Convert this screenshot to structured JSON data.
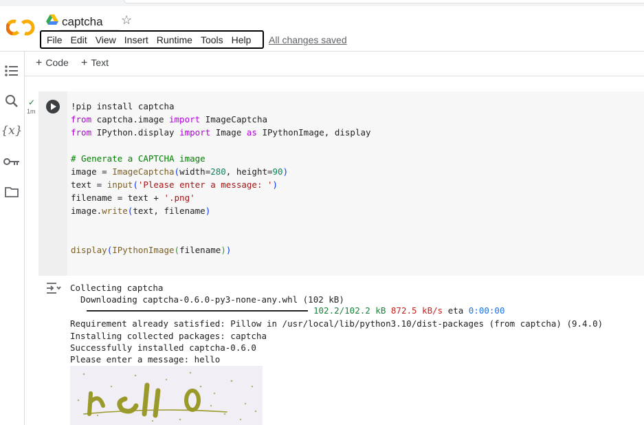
{
  "app": {
    "notebook_title": "captcha",
    "save_status": "All changes saved"
  },
  "menu": [
    "File",
    "Edit",
    "View",
    "Insert",
    "Runtime",
    "Tools",
    "Help"
  ],
  "toolbar": {
    "code_label": "Code",
    "text_label": "Text"
  },
  "sidebar": {
    "icons": [
      "toc-icon",
      "search-icon",
      "variables-icon",
      "key-icon",
      "folder-icon"
    ]
  },
  "cell": {
    "status": "✓",
    "duration": "1m",
    "code_lines": [
      "!pip install captcha",
      "from captcha.image import ImageCaptcha",
      "from IPython.display import Image as IPythonImage, display",
      "",
      "# Generate a CAPTCHA image",
      "image = ImageCaptcha(width=280, height=90)",
      "text = input('Please enter a message: ')",
      "filename = text + '.png'",
      "image.write(text, filename)",
      "",
      "",
      "display(IPythonImage(filename))"
    ]
  },
  "output": {
    "line1": "Collecting captcha",
    "line2": "  Downloading captcha-0.6.0-py3-none-any.whl (102 kB)",
    "progress": {
      "fraction": 1.0,
      "size": "102.2/102.2 kB",
      "speed": "872.5 kB/s",
      "eta_label": "eta",
      "eta": "0:00:00"
    },
    "line4": "Requirement already satisfied: Pillow in /usr/local/lib/python3.10/dist-packages (from captcha) (9.4.0)",
    "line5": "Installing collected packages: captcha",
    "line6": "Successfully installed captcha-0.6.0",
    "line7": "Please enter a message: hello"
  },
  "colors": {
    "accent_orange": "#f9ab00",
    "logo_orange": "#e8710a",
    "captcha_text": "#9a9a2a"
  }
}
